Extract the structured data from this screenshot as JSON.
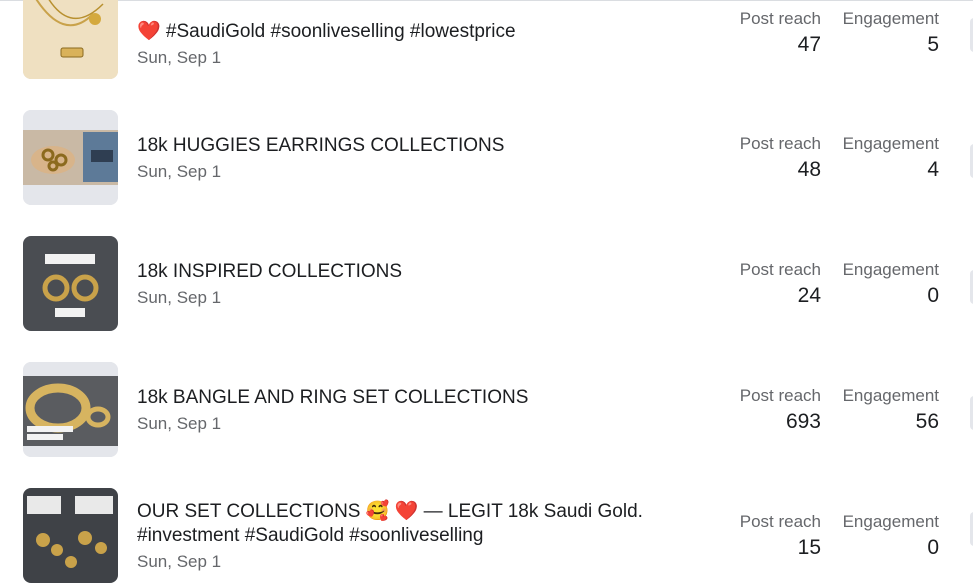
{
  "posts": [
    {
      "title": "❤️ #SaudiGold #soonliveselling #lowestprice",
      "date": "Sun, Sep 1",
      "reach_label": "Post reach",
      "reach": "47",
      "engagement_label": "Engagement",
      "engagement": "5",
      "thumb_icon": "gold-necklace-photo"
    },
    {
      "title": "18k HUGGIES EARRINGS COLLECTIONS",
      "date": "Sun, Sep 1",
      "reach_label": "Post reach",
      "reach": "48",
      "engagement_label": "Engagement",
      "engagement": "4",
      "thumb_icon": "gold-huggies-photo"
    },
    {
      "title": "18k INSPIRED COLLECTIONS",
      "date": "Sun, Sep 1",
      "reach_label": "Post reach",
      "reach": "24",
      "engagement_label": "Engagement",
      "engagement": "0",
      "thumb_icon": "gold-earrings-photo",
      "thumb_caption": "Cartier Earring",
      "thumb_weight": "5.87 gr."
    },
    {
      "title": "18k BANGLE AND RING SET COLLECTIONS",
      "date": "Sun, Sep 1",
      "reach_label": "Post reach",
      "reach": "693",
      "engagement_label": "Engagement",
      "engagement": "56",
      "thumb_icon": "gold-bangle-ring-photo",
      "thumb_caption": "bangle: 14.55 grams",
      "thumb_weight": "ring: 3.70 grams"
    },
    {
      "title_line1": "OUR SET COLLECTIONS 🥰 ❤️ — LEGIT 18k Saudi Gold.",
      "title_line2": "#investment #SaudiGold #soonliveselling",
      "date": "Sun, Sep 1",
      "reach_label": "Post reach",
      "reach": "15",
      "engagement_label": "Engagement",
      "engagement": "0",
      "thumb_icon": "gold-set-photo"
    }
  ],
  "colors": {
    "text_primary": "#1c1e21",
    "text_secondary": "#65676b",
    "thumb_bg": "#e4e6eb",
    "heart": "#e41e3f"
  }
}
